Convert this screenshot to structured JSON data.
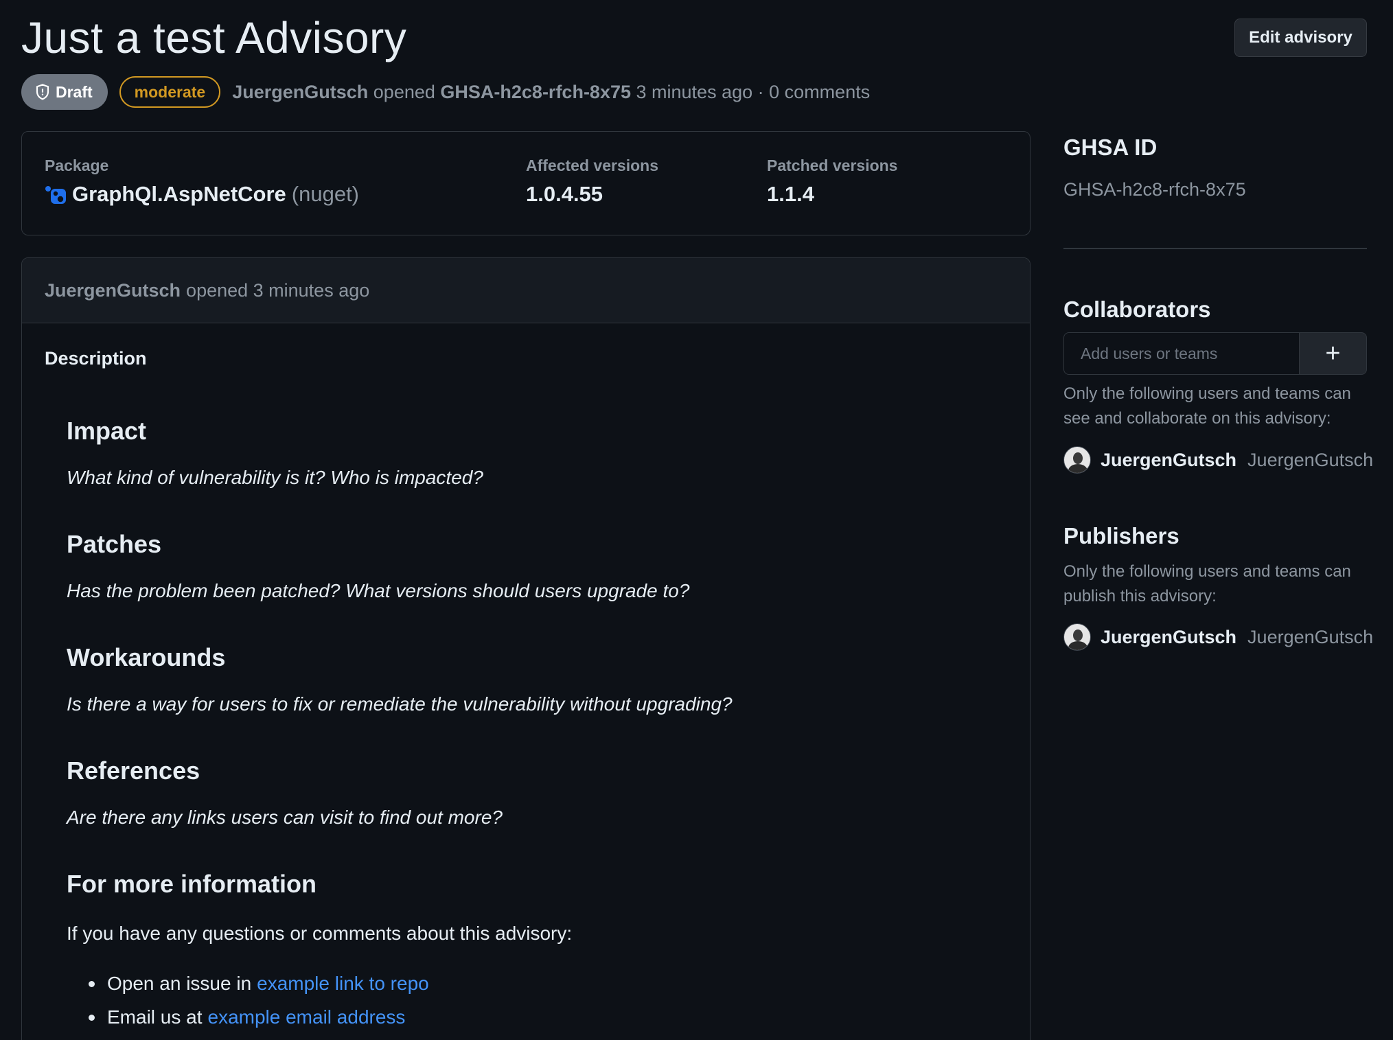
{
  "header": {
    "title": "Just a test Advisory",
    "edit_button": "Edit advisory",
    "status_badge": "Draft",
    "severity_badge": "moderate",
    "author": "JuergenGutsch",
    "opened_word": "opened",
    "advisory_id": "GHSA-h2c8-rfch-8x75",
    "time_ago": "3 minutes ago",
    "separator": "·",
    "comments": "0 comments"
  },
  "package_box": {
    "package_label": "Package",
    "package_name": "GraphQl.AspNetCore",
    "ecosystem": "(nuget)",
    "affected_label": "Affected versions",
    "affected_value": "1.0.4.55",
    "patched_label": "Patched versions",
    "patched_value": "1.1.4"
  },
  "description": {
    "header_author": "JuergenGutsch",
    "header_action": "opened 3 minutes ago",
    "label": "Description",
    "sections": [
      {
        "heading": "Impact",
        "text": "What kind of vulnerability is it? Who is impacted?"
      },
      {
        "heading": "Patches",
        "text": "Has the problem been patched? What versions should users upgrade to?"
      },
      {
        "heading": "Workarounds",
        "text": "Is there a way for users to fix or remediate the vulnerability without upgrading?"
      },
      {
        "heading": "References",
        "text": "Are there any links users can visit to find out more?"
      },
      {
        "heading": "For more information"
      }
    ],
    "more_info_text": "If you have any questions or comments about this advisory:",
    "bullets": [
      {
        "prefix": "Open an issue in",
        "link": "example link to repo"
      },
      {
        "prefix": "Email us at",
        "link": "example email address"
      }
    ]
  },
  "sidebar": {
    "ghsa_heading": "GHSA ID",
    "ghsa_value": "GHSA-h2c8-rfch-8x75",
    "collaborators_heading": "Collaborators",
    "collaborators_placeholder": "Add users or teams",
    "add_button": "+",
    "collaborators_note": "Only the following users and teams can see and collaborate on this advisory:",
    "collaborator": {
      "name": "JuergenGutsch",
      "login": "JuergenGutsch"
    },
    "publishers_heading": "Publishers",
    "publishers_note": "Only the following users and teams can publish this advisory:",
    "publisher": {
      "name": "JuergenGutsch",
      "login": "JuergenGutsch"
    }
  },
  "colors": {
    "background": "#0d1117",
    "severity": "#d29922",
    "link": "#4493f8",
    "draft_badge": "#6e7681"
  }
}
